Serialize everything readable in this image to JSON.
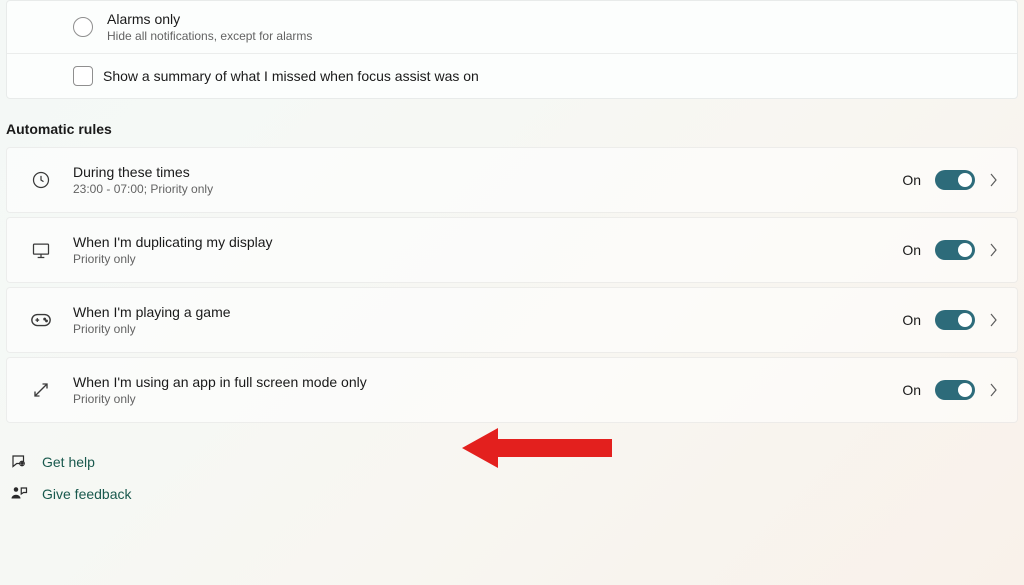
{
  "options": {
    "alarms_only": {
      "title": "Alarms only",
      "subtitle": "Hide all notifications, except for alarms"
    },
    "show_summary": {
      "label": "Show a summary of what I missed when focus assist was on"
    }
  },
  "section_heading": "Automatic rules",
  "rules": [
    {
      "title": "During these times",
      "subtitle": "23:00 - 07:00; Priority only",
      "state": "On"
    },
    {
      "title": "When I'm duplicating my display",
      "subtitle": "Priority only",
      "state": "On"
    },
    {
      "title": "When I'm playing a game",
      "subtitle": "Priority only",
      "state": "On"
    },
    {
      "title": "When I'm using an app in full screen mode only",
      "subtitle": "Priority only",
      "state": "On"
    }
  ],
  "footer": {
    "get_help": "Get help",
    "give_feedback": "Give feedback"
  }
}
